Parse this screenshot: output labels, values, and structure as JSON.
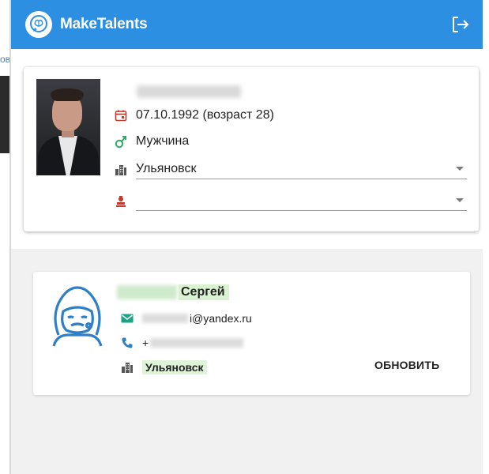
{
  "left_fragment": "ов",
  "header": {
    "brand": "MakeTalents",
    "brand_color": "#2d8fe1",
    "logo_icon": "brain-bubble-icon",
    "logout_icon": "logout-icon"
  },
  "profile": {
    "birth_date": "07.10.1992 (возраст 28)",
    "gender": "Мужчина",
    "city": "Ульяновск",
    "icons": {
      "date": "calendar-icon",
      "gender": "male-symbol-icon",
      "city": "city-buildings-icon",
      "extra": "person-badge-icon"
    }
  },
  "contact": {
    "first_name": "Сергей",
    "email_suffix": "@yandex.ru",
    "email_prefix_visible": "i",
    "phone_prefix": "+",
    "city": "Ульяновск",
    "refresh_label": "ОБНОВИТЬ",
    "icons": {
      "avatar": "astronaut-icon",
      "email": "mail-icon",
      "phone": "phone-icon",
      "city": "city-buildings-icon"
    }
  }
}
